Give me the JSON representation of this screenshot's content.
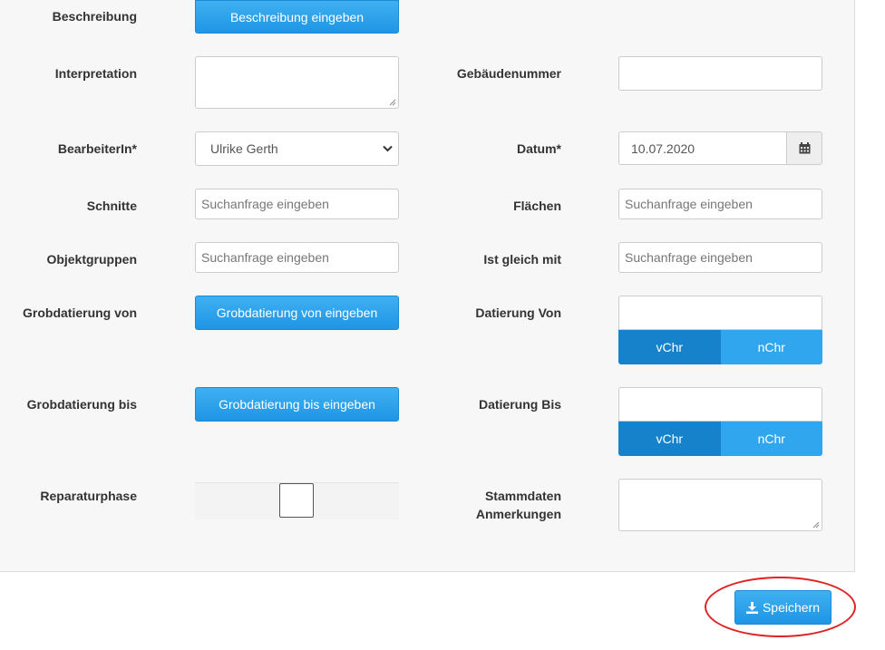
{
  "form": {
    "beschreibung": {
      "label": "Beschreibung",
      "button": "Beschreibung eingeben"
    },
    "interpretation": {
      "label": "Interpretation"
    },
    "gebaeudenummer": {
      "label": "Gebäudenummer",
      "value": ""
    },
    "bearbeiter": {
      "label": "BearbeiterIn*",
      "selected": "Ulrike Gerth"
    },
    "datum": {
      "label": "Datum*",
      "value": "10.07.2020"
    },
    "schnitte": {
      "label": "Schnitte",
      "placeholder": "Suchanfrage eingeben"
    },
    "flaechen": {
      "label": "Flächen",
      "placeholder": "Suchanfrage eingeben"
    },
    "objektgruppen": {
      "label": "Objektgruppen",
      "placeholder": "Suchanfrage eingeben"
    },
    "ist_gleich_mit": {
      "label": "Ist gleich mit",
      "placeholder": "Suchanfrage eingeben"
    },
    "grobdatierung_von": {
      "label": "Grobdatierung von",
      "button": "Grobdatierung von eingeben"
    },
    "datierung_von": {
      "label": "Datierung Von",
      "value": "",
      "era_options": [
        "vChr",
        "nChr"
      ],
      "selected_era": "vChr"
    },
    "grobdatierung_bis": {
      "label": "Grobdatierung bis",
      "button": "Grobdatierung bis eingeben"
    },
    "datierung_bis": {
      "label": "Datierung Bis",
      "value": "",
      "era_options": [
        "vChr",
        "nChr"
      ],
      "selected_era": "vChr"
    },
    "reparaturphase": {
      "label": "Reparaturphase",
      "checked": false
    },
    "stammdaten": {
      "label_line1": "Stammdaten",
      "label_line2": "Anmerkungen"
    }
  },
  "actions": {
    "save_label": "Speichern"
  },
  "colors": {
    "primary": "#1f95e4",
    "active_segment": "#1782cc",
    "highlight_ring": "#e02424",
    "panel_bg": "#f7f7f7"
  },
  "icons": {
    "calendar": "calendar-icon",
    "save": "download-icon",
    "dropdown": "chevron-down-icon"
  }
}
